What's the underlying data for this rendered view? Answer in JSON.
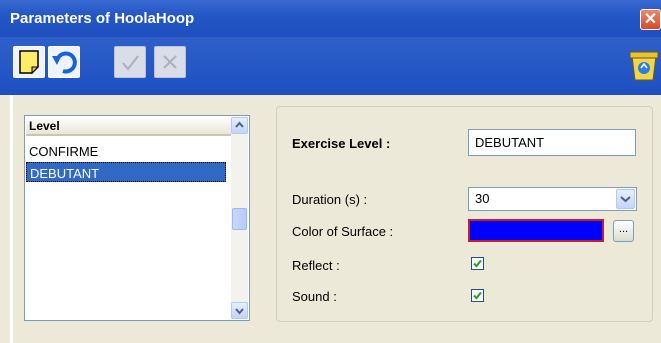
{
  "window": {
    "title": "Parameters of HoolaHoop",
    "close_glyph": "✕"
  },
  "toolbar": {
    "buttons": [
      {
        "name": "new-icon",
        "enabled": true
      },
      {
        "name": "undo-icon",
        "enabled": true
      },
      {
        "name": "validate-icon",
        "enabled": false
      },
      {
        "name": "cancel-icon",
        "enabled": false
      }
    ],
    "trash_icon": "recycle-bin-icon"
  },
  "levels": {
    "header": "Level",
    "items": [
      "CONFIRME",
      "DEBUTANT"
    ],
    "selected": "DEBUTANT"
  },
  "form": {
    "exercise_level_label": "Exercise Level :",
    "exercise_level_value": "DEBUTANT",
    "duration_label": "Duration (s) :",
    "duration_value": "30",
    "color_label": "Color of Surface :",
    "color_value": "#0000ff",
    "color_button_label": "...",
    "reflect_label": "Reflect :",
    "reflect_checked": true,
    "sound_label": "Sound :",
    "sound_checked": true
  }
}
